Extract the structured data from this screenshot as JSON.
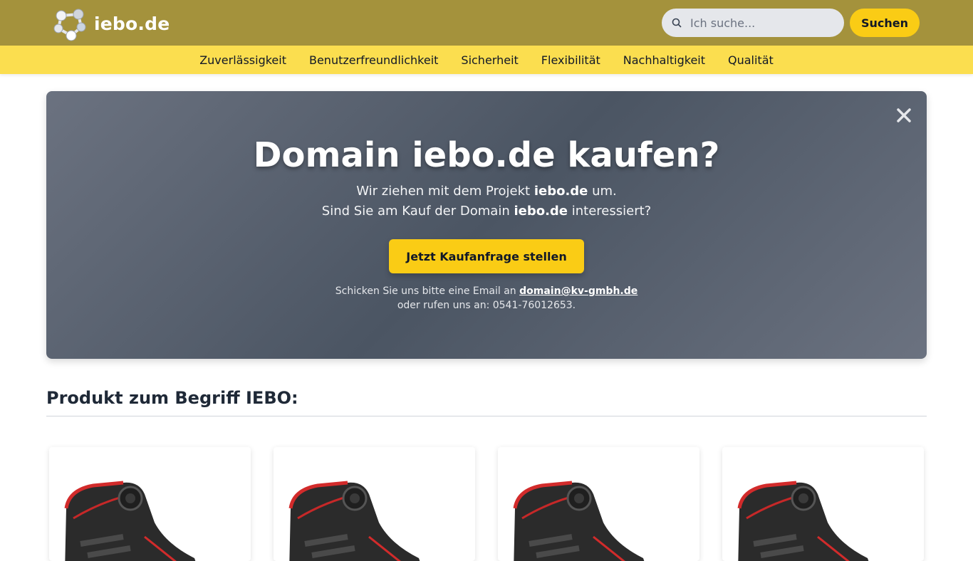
{
  "header": {
    "logo_text": "iebo.de",
    "search_placeholder": "Ich suche...",
    "search_button": "Suchen"
  },
  "nav": {
    "items": [
      "Zuverlässigkeit",
      "Benutzerfreundlichkeit",
      "Sicherheit",
      "Flexibilität",
      "Nachhaltigkeit",
      "Qualität"
    ]
  },
  "hero": {
    "title": "Domain iebo.de kaufen?",
    "line1_pre": "Wir ziehen mit dem Projekt ",
    "line1_bold": "iebo.de",
    "line1_post": " um.",
    "line2_pre": "Sind Sie am Kauf der Domain ",
    "line2_bold": "iebo.de",
    "line2_post": " interessiert?",
    "cta_label": "Jetzt Kaufanfrage stellen",
    "contact_pre": "Schicken Sie uns bitte eine Email an ",
    "contact_email": "domain@kv-gmbh.de",
    "contact_phone_line": "oder rufen uns an: 0541-76012653."
  },
  "products": {
    "section_title": "Produkt zum Begriff IEBO:",
    "count": 4
  },
  "colors": {
    "header_bg": "#a4923c",
    "nav_bg": "#fbde4f",
    "accent_yellow": "#facc15",
    "hero_bg": "#5c6475"
  }
}
